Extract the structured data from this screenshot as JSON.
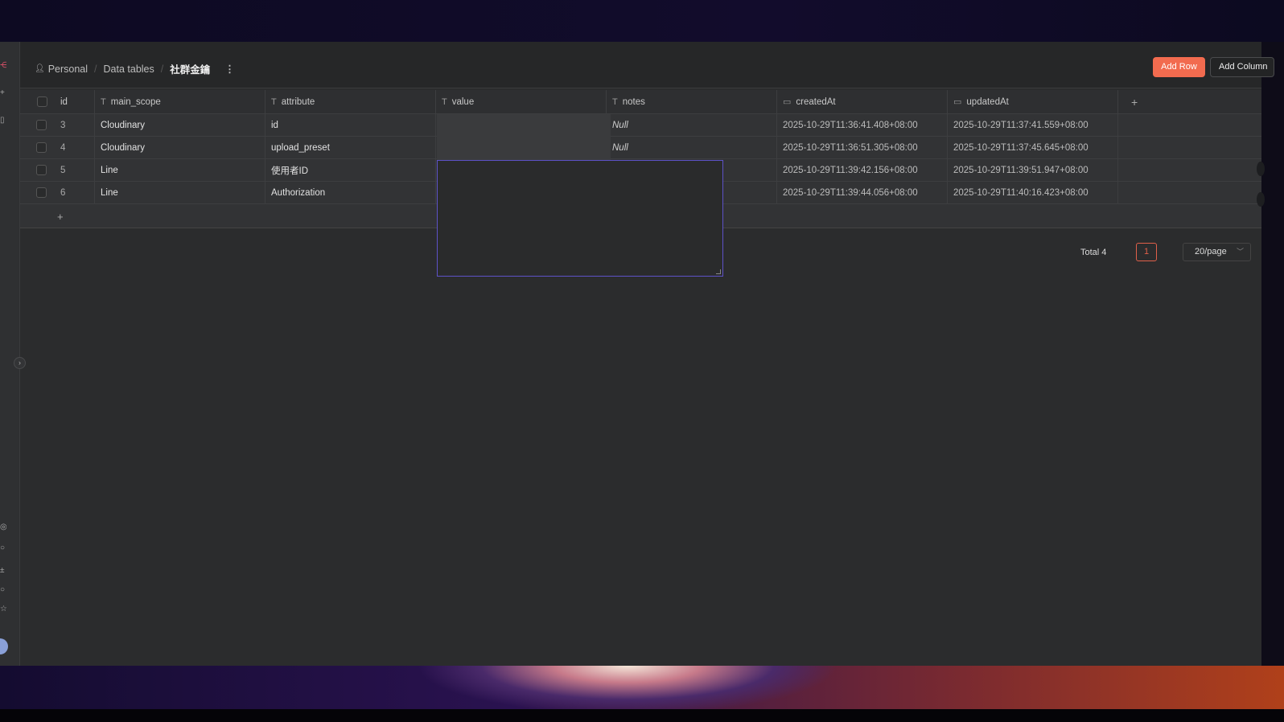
{
  "breadcrumb": {
    "items": [
      "Personal",
      "Data tables",
      "社群金鑰"
    ]
  },
  "toolbar": {
    "add_row": "Add Row",
    "add_column": "Add Column"
  },
  "table": {
    "columns": [
      {
        "label": "id",
        "icon": ""
      },
      {
        "label": "main_scope",
        "icon": "text-type-icon"
      },
      {
        "label": "attribute",
        "icon": "text-type-icon"
      },
      {
        "label": "value",
        "icon": "text-type-icon"
      },
      {
        "label": "notes",
        "icon": "text-type-icon"
      },
      {
        "label": "createdAt",
        "icon": "calendar-icon"
      },
      {
        "label": "updatedAt",
        "icon": "calendar-icon"
      }
    ],
    "add_column_symbol": "+",
    "add_row_symbol": "+",
    "rows": [
      {
        "id": "3",
        "main_scope": "Cloudinary",
        "attribute": "id",
        "value": "",
        "notes": "Null",
        "createdAt": "2025-10-29T11:36:41.408+08:00",
        "updatedAt": "2025-10-29T11:37:41.559+08:00"
      },
      {
        "id": "4",
        "main_scope": "Cloudinary",
        "attribute": "upload_preset",
        "value": "",
        "notes": "Null",
        "createdAt": "2025-10-29T11:36:51.305+08:00",
        "updatedAt": "2025-10-29T11:37:45.645+08:00"
      },
      {
        "id": "5",
        "main_scope": "Line",
        "attribute": "使用者ID",
        "value": "",
        "notes": "",
        "createdAt": "2025-10-29T11:39:42.156+08:00",
        "updatedAt": "2025-10-29T11:39:51.947+08:00"
      },
      {
        "id": "6",
        "main_scope": "Line",
        "attribute": "Authorization",
        "value": "",
        "notes": "",
        "createdAt": "2025-10-29T11:39:44.056+08:00",
        "updatedAt": "2025-10-29T11:40:16.423+08:00"
      }
    ]
  },
  "pagination": {
    "total": "Total 4",
    "current_page": "1",
    "page_size": "20/page"
  },
  "colors": {
    "accent": "#f26b4f",
    "editor_border": "#5d52c8"
  }
}
